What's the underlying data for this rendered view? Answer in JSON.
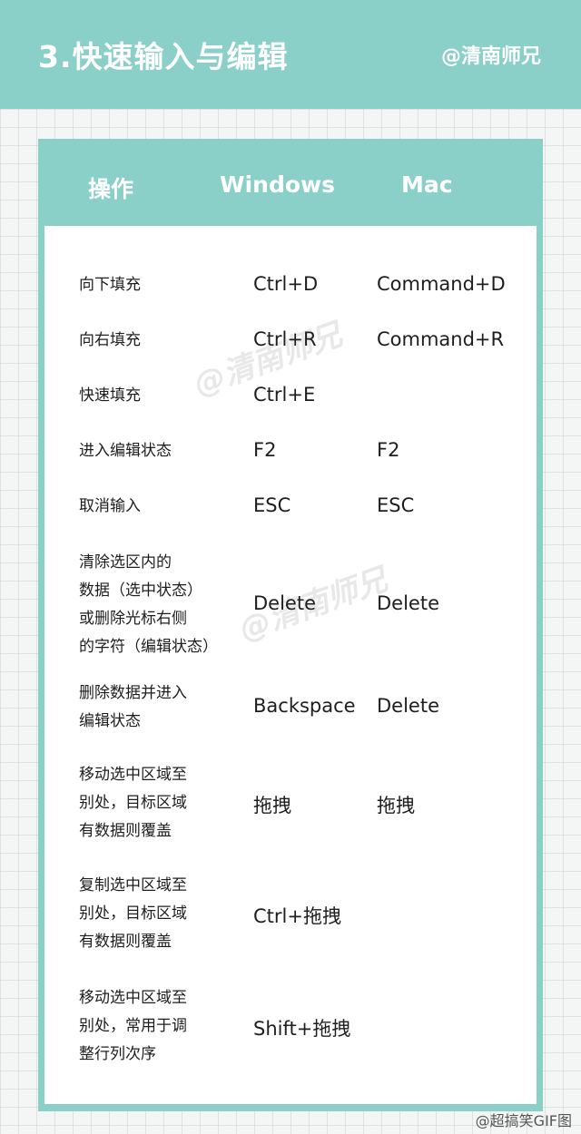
{
  "header": {
    "title": "3.快速输入与编辑",
    "author": "@清南师兄"
  },
  "table": {
    "columns": [
      "操作",
      "Windows",
      "Mac"
    ],
    "rows": [
      {
        "op": [
          "向下填充"
        ],
        "win": "Ctrl+D",
        "mac": "Command+D"
      },
      {
        "op": [
          "向右填充"
        ],
        "win": "Ctrl+R",
        "mac": "Command+R"
      },
      {
        "op": [
          "快速填充"
        ],
        "win": "Ctrl+E",
        "mac": ""
      },
      {
        "op": [
          "进入编辑状态"
        ],
        "win": "F2",
        "mac": "F2"
      },
      {
        "op": [
          "取消输入"
        ],
        "win": "ESC",
        "mac": "ESC"
      },
      {
        "op": [
          "清除选区内的",
          "数据（选中状态）",
          "或删除光标右侧",
          "的字符（编辑状态）"
        ],
        "win": "Delete",
        "mac": "Delete"
      },
      {
        "op": [
          "删除数据并进入",
          "编辑状态"
        ],
        "win": "Backspace",
        "mac": "Delete"
      },
      {
        "op": [
          "移动选中区域至",
          "别处，目标区域",
          "有数据则覆盖"
        ],
        "win": "拖拽",
        "mac": "拖拽"
      },
      {
        "op": [
          "复制选中区域至",
          "别处，目标区域",
          "有数据则覆盖"
        ],
        "win": "Ctrl+拖拽",
        "mac": ""
      },
      {
        "op": [
          "移动选中区域至",
          "别处，常用于调",
          "整行列次序"
        ],
        "win": "Shift+拖拽",
        "mac": ""
      }
    ]
  },
  "watermark": "@清南师兄",
  "bottom_mark": "@超搞笑GIF图"
}
